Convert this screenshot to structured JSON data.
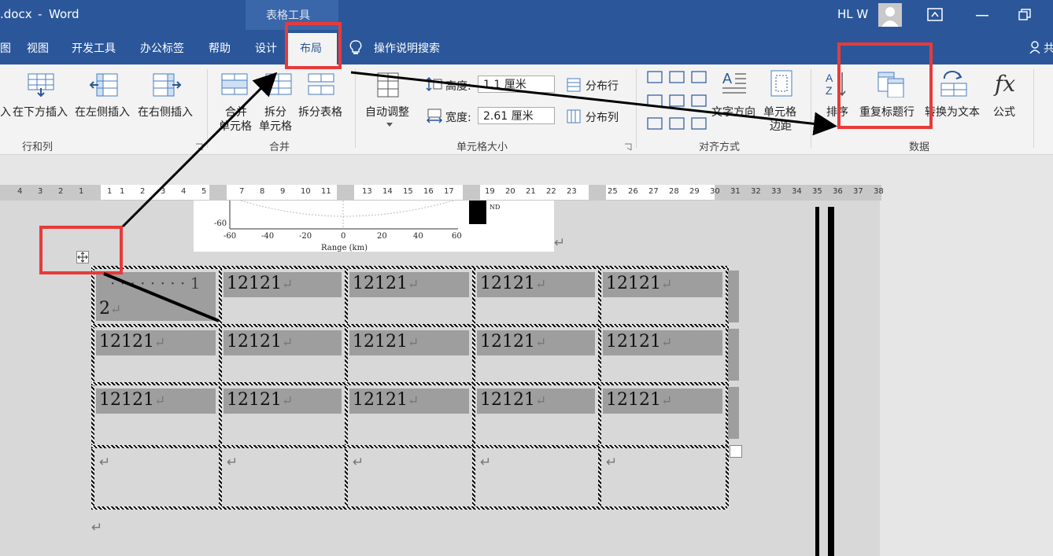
{
  "titlebar": {
    "document": ".docx",
    "separator": "-",
    "app": "Word",
    "context_tools": "表格工具",
    "user": "HL W"
  },
  "tabs": [
    "图",
    "视图",
    "开发工具",
    "办公标签",
    "帮助",
    "设计",
    "布局"
  ],
  "tell_me": "操作说明搜索",
  "share_fragment": "共",
  "ribbon": {
    "rows_cols": {
      "insert_left_fragment": "入",
      "insert_below": "在下方插入",
      "insert_left": "在左侧插入",
      "insert_right": "在右侧插入",
      "group": "行和列"
    },
    "merge": {
      "merge_cells_1": "合并",
      "merge_cells_2": "单元格",
      "split_cells_1": "拆分",
      "split_cells_2": "单元格",
      "split_table": "拆分表格",
      "group": "合并"
    },
    "cell_size": {
      "autofit": "自动调整",
      "height_label": "高度:",
      "height_value": "1.1 厘米",
      "width_label": "宽度:",
      "width_value": "2.61 厘米",
      "distribute_rows": "分布行",
      "distribute_cols": "分布列",
      "group": "单元格大小"
    },
    "alignment": {
      "text_direction": "文字方向",
      "cell_margins_1": "单元格",
      "cell_margins_2": "边距",
      "group": "对齐方式"
    },
    "data": {
      "sort": "排序",
      "repeat_header": "重复标题行",
      "convert_text": "转换为文本",
      "formula": "公式",
      "group": "数据"
    }
  },
  "ruler": {
    "left_numbers": [
      "4",
      "3",
      "2",
      "1"
    ],
    "numbers": [
      "1",
      "1",
      "2",
      "3",
      "4",
      "5",
      "7",
      "8",
      "9",
      "10",
      "11",
      "13",
      "14",
      "15",
      "16",
      "17",
      "19",
      "20",
      "21",
      "22",
      "23",
      "25",
      "26",
      "27",
      "28",
      "29",
      "30",
      "31",
      "32",
      "33",
      "34",
      "35",
      "36",
      "37",
      "38"
    ]
  },
  "chart": {
    "y_tick": "-60",
    "x_ticks": [
      "-60",
      "-40",
      "-20",
      "0",
      "20",
      "40",
      "60"
    ],
    "xlabel": "Range (km)",
    "legend": "ND"
  },
  "table": {
    "first_cell_a": "· · · · · · · · 1",
    "first_cell_b": "2",
    "cell_value": "12121",
    "para_mark": "↵"
  },
  "colors": {
    "titlebar": "#2b579a",
    "highlight": "#e83a3a"
  }
}
